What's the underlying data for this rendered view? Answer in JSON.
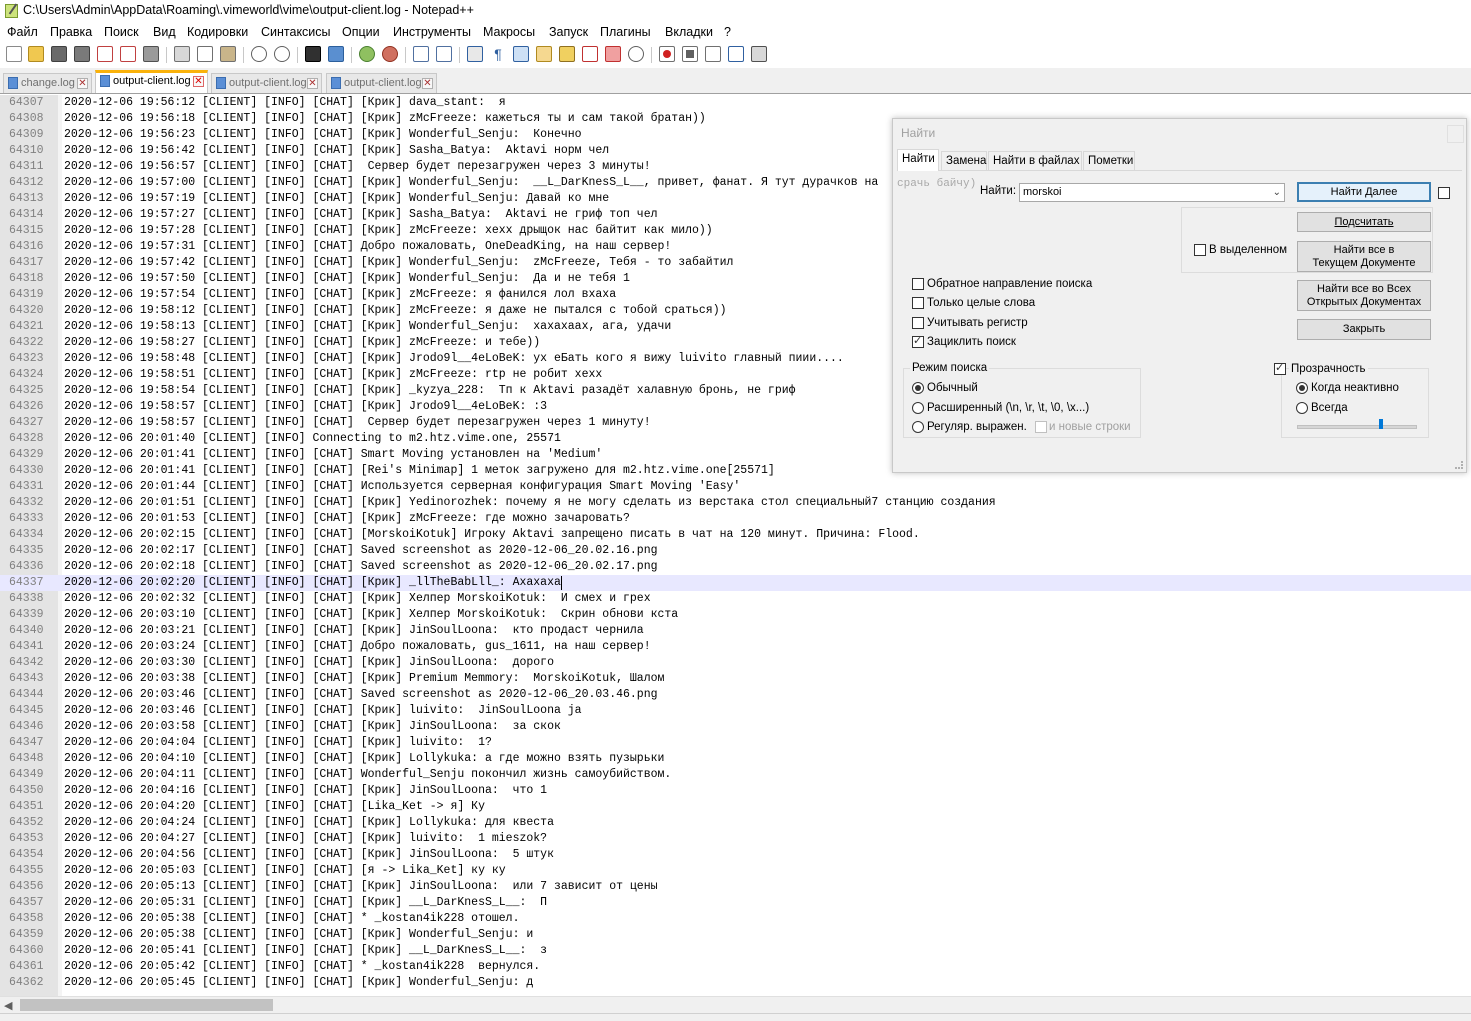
{
  "window": {
    "title": "C:\\Users\\Admin\\AppData\\Roaming\\.vimeworld\\vime\\output-client.log - Notepad++"
  },
  "menu": [
    "Файл",
    "Правка",
    "Поиск",
    "Вид",
    "Кодировки",
    "Синтаксисы",
    "Опции",
    "Инструменты",
    "Макросы",
    "Запуск",
    "Плагины",
    "Вкладки",
    "?"
  ],
  "tabs": [
    {
      "label": "change.log",
      "active": false
    },
    {
      "label": "output-client.log",
      "active": true
    },
    {
      "label": "output-client.log",
      "active": false
    },
    {
      "label": "output-client.log",
      "active": false
    }
  ],
  "editor": {
    "current_line": "64337",
    "lines": [
      {
        "n": "64307",
        "text": "2020-12-06 19:56:12 [CLIENT] [INFO] [CHAT] [Крик] dava_stant:  я"
      },
      {
        "n": "64308",
        "text": "2020-12-06 19:56:18 [CLIENT] [INFO] [CHAT] [Крик] zMcFreeze: кажеться ты и сам такой братан))"
      },
      {
        "n": "64309",
        "text": "2020-12-06 19:56:23 [CLIENT] [INFO] [CHAT] [Крик] Wonderful_Senju:  Конечно"
      },
      {
        "n": "64310",
        "text": "2020-12-06 19:56:42 [CLIENT] [INFO] [CHAT] [Крик] Sasha_Batya:  Aktavi норм чел"
      },
      {
        "n": "64311",
        "text": "2020-12-06 19:56:57 [CLIENT] [INFO] [CHAT]  Сервер будет перезагружен через 3 минуты!"
      },
      {
        "n": "64312",
        "text": "2020-12-06 19:57:00 [CLIENT] [INFO] [CHAT] [Крик] Wonderful_Senju:  __L_DarKnesS_L__, привет, фанат. Я тут дурачков на"
      },
      {
        "n": "64313",
        "text": "2020-12-06 19:57:19 [CLIENT] [INFO] [CHAT] [Крик] Wonderful_Senju: Давай ко мне"
      },
      {
        "n": "64314",
        "text": "2020-12-06 19:57:27 [CLIENT] [INFO] [CHAT] [Крик] Sasha_Batya:  Aktavi не гриф топ чел"
      },
      {
        "n": "64315",
        "text": "2020-12-06 19:57:28 [CLIENT] [INFO] [CHAT] [Крик] zMcFreeze: хехх дрыщок нас байтит как мило))"
      },
      {
        "n": "64316",
        "text": "2020-12-06 19:57:31 [CLIENT] [INFO] [CHAT] Добро пожаловать, OneDeadKing, на наш сервер!"
      },
      {
        "n": "64317",
        "text": "2020-12-06 19:57:42 [CLIENT] [INFO] [CHAT] [Крик] Wonderful_Senju:  zMcFreeze, Тебя - то забайтил"
      },
      {
        "n": "64318",
        "text": "2020-12-06 19:57:50 [CLIENT] [INFO] [CHAT] [Крик] Wonderful_Senju:  Да и не тебя 1"
      },
      {
        "n": "64319",
        "text": "2020-12-06 19:57:54 [CLIENT] [INFO] [CHAT] [Крик] zMcFreeze: я фанился лол вхаха"
      },
      {
        "n": "64320",
        "text": "2020-12-06 19:58:12 [CLIENT] [INFO] [CHAT] [Крик] zMcFreeze: я даже не пытался с тобой сраться))"
      },
      {
        "n": "64321",
        "text": "2020-12-06 19:58:13 [CLIENT] [INFO] [CHAT] [Крик] Wonderful_Senju:  хахахаах, ага, удачи"
      },
      {
        "n": "64322",
        "text": "2020-12-06 19:58:27 [CLIENT] [INFO] [CHAT] [Крик] zMcFreeze: и тебе))"
      },
      {
        "n": "64323",
        "text": "2020-12-06 19:58:48 [CLIENT] [INFO] [CHAT] [Крик] Jrodo9l__4eLoBeK: ух еБать кого я вижу luivito главный пиии...."
      },
      {
        "n": "64324",
        "text": "2020-12-06 19:58:51 [CLIENT] [INFO] [CHAT] [Крик] zMcFreeze: rtp не робит хехх"
      },
      {
        "n": "64325",
        "text": "2020-12-06 19:58:54 [CLIENT] [INFO] [CHAT] [Крик] _kyzya_228:  Тп к Aktavi разадёт халавную бронь, не гриф"
      },
      {
        "n": "64326",
        "text": "2020-12-06 19:58:57 [CLIENT] [INFO] [CHAT] [Крик] Jrodo9l__4eLoBeK: :3"
      },
      {
        "n": "64327",
        "text": "2020-12-06 19:58:57 [CLIENT] [INFO] [CHAT]  Сервер будет перезагружен через 1 минуту!"
      },
      {
        "n": "64328",
        "text": "2020-12-06 20:01:40 [CLIENT] [INFO] Connecting to m2.htz.vime.one, 25571"
      },
      {
        "n": "64329",
        "text": "2020-12-06 20:01:41 [CLIENT] [INFO] [CHAT] Smart Moving установлен на 'Medium'"
      },
      {
        "n": "64330",
        "text": "2020-12-06 20:01:41 [CLIENT] [INFO] [CHAT] [Rei's Minimap] 1 меток загружено для m2.htz.vime.one[25571]"
      },
      {
        "n": "64331",
        "text": "2020-12-06 20:01:44 [CLIENT] [INFO] [CHAT] Используется серверная конфигурация Smart Moving 'Easy'"
      },
      {
        "n": "64332",
        "text": "2020-12-06 20:01:51 [CLIENT] [INFO] [CHAT] [Крик] Yedinorozhek: почему я не могу сделать из верстака стол специальный7 станцию создания"
      },
      {
        "n": "64333",
        "text": "2020-12-06 20:01:53 [CLIENT] [INFO] [CHAT] [Крик] zMcFreeze: где можно зачаровать?"
      },
      {
        "n": "64334",
        "text": "2020-12-06 20:02:15 [CLIENT] [INFO] [CHAT] [MorskoiKotuk] Игроку Aktavi запрещено писать в чат на 120 минут. Причина: Flood."
      },
      {
        "n": "64335",
        "text": "2020-12-06 20:02:17 [CLIENT] [INFO] [CHAT] Saved screenshot as 2020-12-06_20.02.16.png"
      },
      {
        "n": "64336",
        "text": "2020-12-06 20:02:18 [CLIENT] [INFO] [CHAT] Saved screenshot as 2020-12-06_20.02.17.png"
      },
      {
        "n": "64337",
        "text": "2020-12-06 20:02:20 [CLIENT] [INFO] [CHAT] [Крик] _llTheBabLll_: Ахахаха"
      },
      {
        "n": "64338",
        "text": "2020-12-06 20:02:32 [CLIENT] [INFO] [CHAT] [Крик] Хелпер MorskoiKotuk:  И смех и грех"
      },
      {
        "n": "64339",
        "text": "2020-12-06 20:03:10 [CLIENT] [INFO] [CHAT] [Крик] Хелпер MorskoiKotuk:  Скрин обнови кста"
      },
      {
        "n": "64340",
        "text": "2020-12-06 20:03:21 [CLIENT] [INFO] [CHAT] [Крик] JinSoulLoona:  кто продаст чернила"
      },
      {
        "n": "64341",
        "text": "2020-12-06 20:03:24 [CLIENT] [INFO] [CHAT] Добро пожаловать, gus_1611, на наш сервер!"
      },
      {
        "n": "64342",
        "text": "2020-12-06 20:03:30 [CLIENT] [INFO] [CHAT] [Крик] JinSoulLoona:  дорого"
      },
      {
        "n": "64343",
        "text": "2020-12-06 20:03:38 [CLIENT] [INFO] [CHAT] [Крик] Premium Memmory:  MorskoiKotuk, Шалом"
      },
      {
        "n": "64344",
        "text": "2020-12-06 20:03:46 [CLIENT] [INFO] [CHAT] Saved screenshot as 2020-12-06_20.03.46.png"
      },
      {
        "n": "64345",
        "text": "2020-12-06 20:03:46 [CLIENT] [INFO] [CHAT] [Крик] luivito:  JinSoulLoona ja"
      },
      {
        "n": "64346",
        "text": "2020-12-06 20:03:58 [CLIENT] [INFO] [CHAT] [Крик] JinSoulLoona:  за скок"
      },
      {
        "n": "64347",
        "text": "2020-12-06 20:04:04 [CLIENT] [INFO] [CHAT] [Крик] luivito:  1?"
      },
      {
        "n": "64348",
        "text": "2020-12-06 20:04:10 [CLIENT] [INFO] [CHAT] [Крик] Lollykuka: а где можно взять пузырьки"
      },
      {
        "n": "64349",
        "text": "2020-12-06 20:04:11 [CLIENT] [INFO] [CHAT] Wonderful_Senju покончил жизнь самоубийством."
      },
      {
        "n": "64350",
        "text": "2020-12-06 20:04:16 [CLIENT] [INFO] [CHAT] [Крик] JinSoulLoona:  что 1"
      },
      {
        "n": "64351",
        "text": "2020-12-06 20:04:20 [CLIENT] [INFO] [CHAT] [Lika_Ket -> я] Ку"
      },
      {
        "n": "64352",
        "text": "2020-12-06 20:04:24 [CLIENT] [INFO] [CHAT] [Крик] Lollykuka: для квеста"
      },
      {
        "n": "64353",
        "text": "2020-12-06 20:04:27 [CLIENT] [INFO] [CHAT] [Крик] luivito:  1 mieszok?"
      },
      {
        "n": "64354",
        "text": "2020-12-06 20:04:56 [CLIENT] [INFO] [CHAT] [Крик] JinSoulLoona:  5 штук"
      },
      {
        "n": "64355",
        "text": "2020-12-06 20:05:03 [CLIENT] [INFO] [CHAT] [я -> Lika_Ket] ку ку"
      },
      {
        "n": "64356",
        "text": "2020-12-06 20:05:13 [CLIENT] [INFO] [CHAT] [Крик] JinSoulLoona:  или 7 зависит от цены"
      },
      {
        "n": "64357",
        "text": "2020-12-06 20:05:31 [CLIENT] [INFO] [CHAT] [Крик] __L_DarKnesS_L__:  П"
      },
      {
        "n": "64358",
        "text": "2020-12-06 20:05:38 [CLIENT] [INFO] [CHAT] * _kostan4ik228 отошел."
      },
      {
        "n": "64359",
        "text": "2020-12-06 20:05:38 [CLIENT] [INFO] [CHAT] [Крик] Wonderful_Senju: и"
      },
      {
        "n": "64360",
        "text": "2020-12-06 20:05:41 [CLIENT] [INFO] [CHAT] [Крик] __L_DarKnesS_L__:  з"
      },
      {
        "n": "64361",
        "text": "2020-12-06 20:05:42 [CLIENT] [INFO] [CHAT] * _kostan4ik228  вернулся."
      },
      {
        "n": "64362",
        "text": "2020-12-06 20:05:45 [CLIENT] [INFO] [CHAT] [Крик] Wonderful_Senju: д"
      }
    ]
  },
  "find_dialog": {
    "title": "Найти",
    "tabs": [
      "Найти",
      "Замена",
      "Найти в файлах",
      "Пометки"
    ],
    "active_tab": "Найти",
    "background_text": "срачь байчу)",
    "find_label": "Найти:",
    "find_value": "morskoi",
    "buttons": {
      "find_next": "Найти Далее",
      "count": "Подсчитать",
      "find_all_current_1": "Найти все в",
      "find_all_current_2": "Текущем Документе",
      "find_all_open_1": "Найти все во Всех",
      "find_all_open_2": "Открытых Документах",
      "close": "Закрыть"
    },
    "in_selection": {
      "label": "В выделенном",
      "checked": false
    },
    "options": [
      {
        "label": "Обратное направление поиска",
        "checked": false
      },
      {
        "label": "Только целые слова",
        "checked": false
      },
      {
        "label": "Учитывать регистр",
        "checked": false
      },
      {
        "label": "Зациклить поиск",
        "checked": true
      }
    ],
    "search_mode": {
      "title": "Режим поиска",
      "options": [
        {
          "label": "Обычный",
          "checked": true
        },
        {
          "label": "Расширенный (\\n, \\r, \\t, \\0, \\x...)",
          "checked": false
        },
        {
          "label": "Регуляр. выражен.",
          "checked": false
        }
      ],
      "newlines_label": "и новые строки"
    },
    "transparency": {
      "label": "Прозрачность",
      "checked": true,
      "options": [
        {
          "label": "Когда неактивно",
          "checked": true
        },
        {
          "label": "Всегда",
          "checked": false
        }
      ],
      "level": 0.7
    }
  }
}
